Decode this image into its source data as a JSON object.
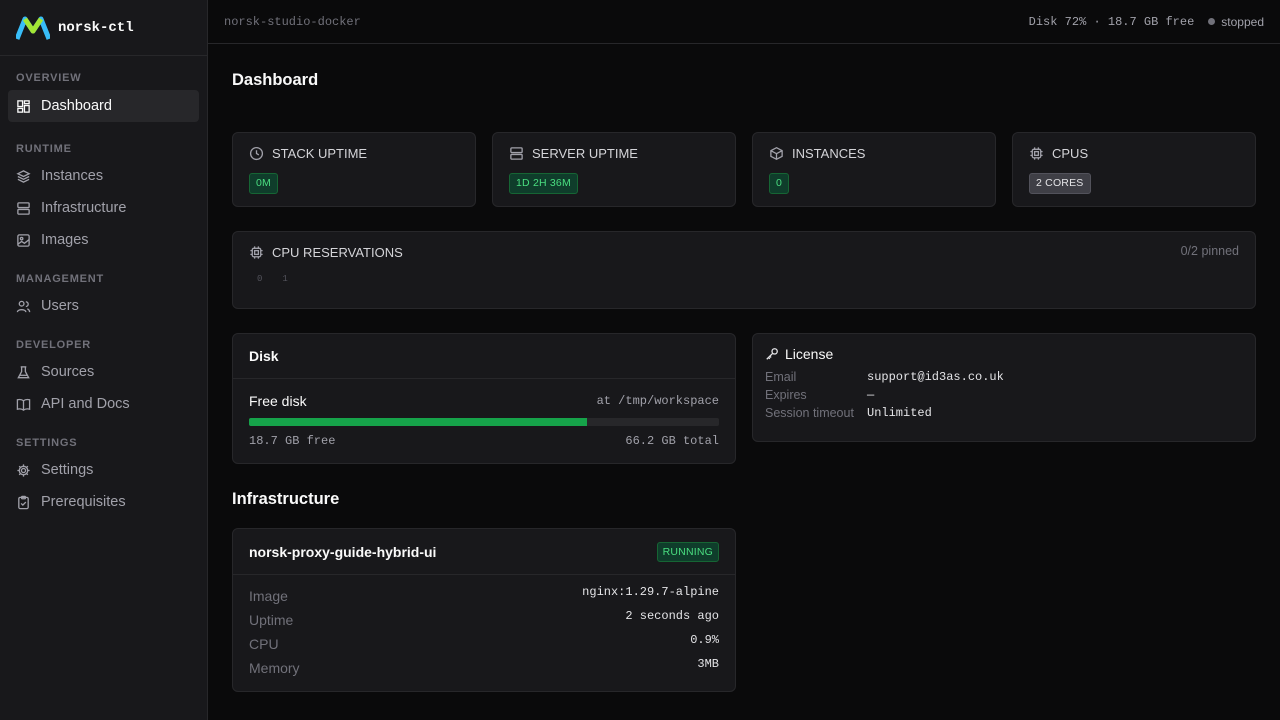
{
  "app": {
    "name": "norsk-ctl"
  },
  "topbar": {
    "title": "norsk-studio-docker",
    "disk": "Disk 72% · 18.7 GB free",
    "status": "stopped"
  },
  "sidebar": {
    "sections": [
      {
        "label": "OVERVIEW",
        "items": [
          {
            "label": "Dashboard",
            "icon": "dashboard-icon",
            "active": true
          }
        ]
      },
      {
        "label": "RUNTIME",
        "items": [
          {
            "label": "Instances",
            "icon": "layers-icon"
          },
          {
            "label": "Infrastructure",
            "icon": "server-icon"
          },
          {
            "label": "Images",
            "icon": "image-icon"
          }
        ]
      },
      {
        "label": "MANAGEMENT",
        "items": [
          {
            "label": "Users",
            "icon": "users-icon"
          }
        ]
      },
      {
        "label": "DEVELOPER",
        "items": [
          {
            "label": "Sources",
            "icon": "flask-icon"
          },
          {
            "label": "API and Docs",
            "icon": "book-icon"
          }
        ]
      },
      {
        "label": "SETTINGS",
        "items": [
          {
            "label": "Settings",
            "icon": "gear-icon"
          },
          {
            "label": "Prerequisites",
            "icon": "clipboard-check-icon"
          }
        ]
      }
    ]
  },
  "page": {
    "title": "Dashboard"
  },
  "stats": [
    {
      "label": "STACK UPTIME",
      "value": "0M",
      "icon": "clock-icon",
      "tone": "green"
    },
    {
      "label": "SERVER UPTIME",
      "value": "1D 2H 36M",
      "icon": "server-icon",
      "tone": "green"
    },
    {
      "label": "INSTANCES",
      "value": "0",
      "icon": "box-icon",
      "tone": "green"
    },
    {
      "label": "CPUS",
      "value": "2 CORES",
      "icon": "cpu-icon",
      "tone": "gray"
    }
  ],
  "cpu_reservations": {
    "label": "CPU RESERVATIONS",
    "pinned": "0/2 pinned",
    "cores": [
      "0",
      "1"
    ]
  },
  "disk": {
    "title": "Disk",
    "label": "Free disk",
    "path": "at /tmp/workspace",
    "used_fraction": 0.72,
    "free": "18.7 GB free",
    "total": "66.2 GB total"
  },
  "license": {
    "title": "License",
    "rows": [
      {
        "key": "Email",
        "value": "support@id3as.co.uk"
      },
      {
        "key": "Expires",
        "value": "—"
      },
      {
        "key": "Session timeout",
        "value": "Unlimited"
      }
    ]
  },
  "infrastructure": {
    "title": "Infrastructure",
    "item": {
      "name": "norsk-proxy-guide-hybrid-ui",
      "status": "RUNNING",
      "rows": [
        {
          "key": "Image",
          "value": "nginx:1.29.7-alpine"
        },
        {
          "key": "Uptime",
          "value": "2 seconds ago"
        },
        {
          "key": "CPU",
          "value": "0.9%"
        },
        {
          "key": "Memory",
          "value": "3MB"
        }
      ]
    }
  },
  "colors": {
    "accent_green": "#16a34a",
    "background": "#0a0a0b",
    "card": "#18181b"
  }
}
